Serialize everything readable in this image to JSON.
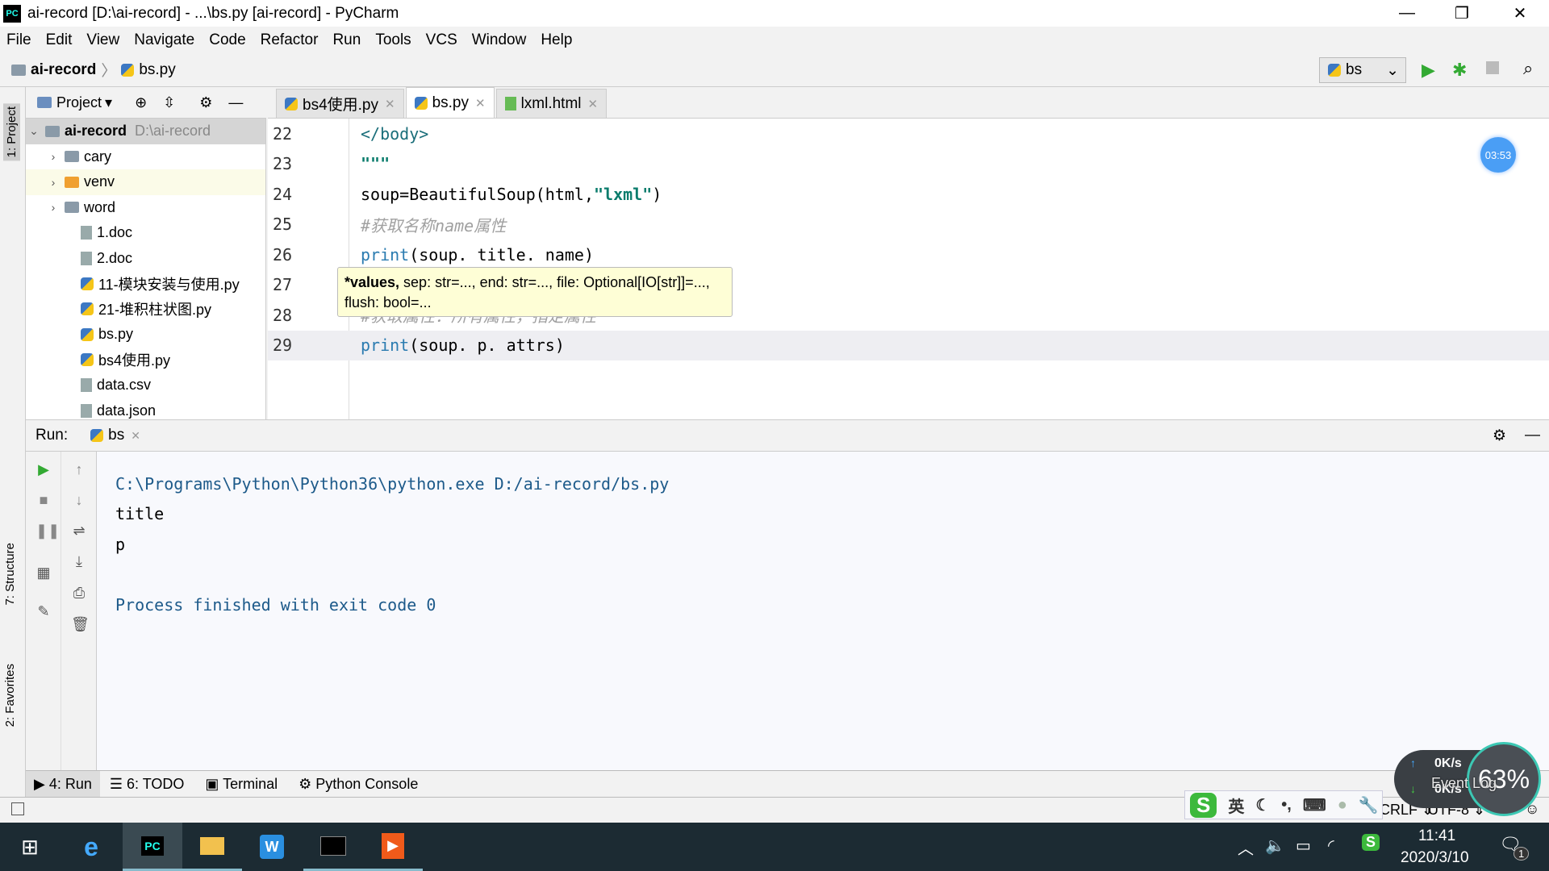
{
  "window": {
    "title": "ai-record [D:\\ai-record] - ...\\bs.py [ai-record] - PyCharm",
    "logo": "PC"
  },
  "menu": [
    "File",
    "Edit",
    "View",
    "Navigate",
    "Code",
    "Refactor",
    "Run",
    "Tools",
    "VCS",
    "Window",
    "Help"
  ],
  "breadcrumb": [
    "ai-record",
    "bs.py"
  ],
  "run_config": "bs",
  "project": {
    "label": "Project",
    "root": "ai-record",
    "root_path": "D:\\ai-record",
    "items": [
      "cary",
      "venv",
      "word",
      "1.doc",
      "2.doc",
      "11-模块安装与使用.py",
      "21-堆积柱状图.py",
      "bs.py",
      "bs4使用.py",
      "data.csv",
      "data.json"
    ]
  },
  "tabs": [
    "bs4使用.py",
    "bs.py",
    "lxml.html"
  ],
  "editor": {
    "lines": [
      {
        "n": "22",
        "code": "</body>"
      },
      {
        "n": "23",
        "code": "\"\"\""
      },
      {
        "n": "24",
        "code_a": "soup=BeautifulSoup(html,",
        "code_b": "\"lxml\"",
        "code_c": ")"
      },
      {
        "n": "25",
        "code": "#获取名称name属性"
      },
      {
        "n": "26",
        "kw": "print",
        "code": "(soup. title. name)"
      },
      {
        "n": "27",
        "code": ""
      },
      {
        "n": "28",
        "code": "#获取属性：所有属性，指定属性"
      },
      {
        "n": "29",
        "kw": "print",
        "code": "(soup. p. attrs)"
      }
    ],
    "timer": "03:53"
  },
  "tooltip": {
    "bold": "*values,",
    "rest": " sep: str=..., end: str=..., file: Optional[IO[str]]=...,",
    "line2": "flush: bool=..."
  },
  "run": {
    "label": "Run:",
    "tab": "bs",
    "output": [
      "C:\\Programs\\Python\\Python36\\python.exe D:/ai-record/bs.py",
      "title",
      "p",
      "",
      "Process finished with exit code 0"
    ]
  },
  "side_tabs": {
    "project": "1: Project",
    "structure": "7: Structure",
    "favorites": "2: Favorites"
  },
  "bottom_tabs": [
    "4: Run",
    "6: TODO",
    "Terminal",
    "Python Console"
  ],
  "status": {
    "line_sep": "CRLF ⇕",
    "encoding": "UTF-8 ⇕",
    "event_log": "Event Log"
  },
  "ime": {
    "lang": "英"
  },
  "net": {
    "up": "0K/s",
    "down": "0K/s",
    "cpu": "63%"
  },
  "taskbar": {
    "time": "11:41",
    "date": "2020/3/10",
    "notifications": "1"
  }
}
